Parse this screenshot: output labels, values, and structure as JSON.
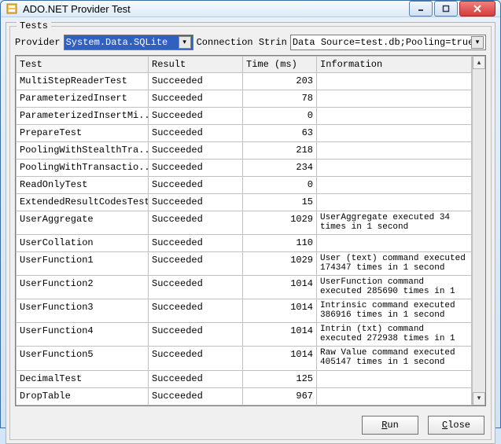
{
  "window": {
    "title": "ADO.NET Provider Test"
  },
  "group": {
    "label": "Tests"
  },
  "toolbar": {
    "provider_label": "Provider",
    "provider_value": "System.Data.SQLite",
    "conn_label": "Connection Strin",
    "conn_value": "Data Source=test.db;Pooling=true;FailIfM"
  },
  "grid": {
    "columns": [
      "Test",
      "Result",
      "Time (ms)",
      "Information"
    ],
    "rows": [
      {
        "test": "MultiStepReaderTest",
        "result": "Succeeded",
        "time": "203",
        "info": ""
      },
      {
        "test": "ParameterizedInsert",
        "result": "Succeeded",
        "time": "78",
        "info": ""
      },
      {
        "test": "ParameterizedInsertMi...",
        "result": "Succeeded",
        "time": "0",
        "info": ""
      },
      {
        "test": "PrepareTest",
        "result": "Succeeded",
        "time": "63",
        "info": ""
      },
      {
        "test": "PoolingWithStealthTra...",
        "result": "Succeeded",
        "time": "218",
        "info": ""
      },
      {
        "test": "PoolingWithTransactio...",
        "result": "Succeeded",
        "time": "234",
        "info": ""
      },
      {
        "test": "ReadOnlyTest",
        "result": "Succeeded",
        "time": "0",
        "info": ""
      },
      {
        "test": "ExtendedResultCodesTest",
        "result": "Succeeded",
        "time": "15",
        "info": ""
      },
      {
        "test": "UserAggregate",
        "result": "Succeeded",
        "time": "1029",
        "info": "UserAggregate executed 34 times in 1 second"
      },
      {
        "test": "UserCollation",
        "result": "Succeeded",
        "time": "110",
        "info": ""
      },
      {
        "test": "UserFunction1",
        "result": "Succeeded",
        "time": "1029",
        "info": "User (text) command executed 174347 times in 1 second"
      },
      {
        "test": "UserFunction2",
        "result": "Succeeded",
        "time": "1014",
        "info": "UserFunction command executed 285690 times in 1"
      },
      {
        "test": "UserFunction3",
        "result": "Succeeded",
        "time": "1014",
        "info": "Intrinsic command executed 386916 times in 1 second"
      },
      {
        "test": "UserFunction4",
        "result": "Succeeded",
        "time": "1014",
        "info": "Intrin (txt) command executed 272938 times in 1"
      },
      {
        "test": "UserFunction5",
        "result": "Succeeded",
        "time": "1014",
        "info": "Raw Value command executed 405147 times in 1 second"
      },
      {
        "test": "DecimalTest",
        "result": "Succeeded",
        "time": "125",
        "info": ""
      },
      {
        "test": "DropTable",
        "result": "Succeeded",
        "time": "967",
        "info": ""
      }
    ]
  },
  "buttons": {
    "run": "Run",
    "close": "Close"
  }
}
